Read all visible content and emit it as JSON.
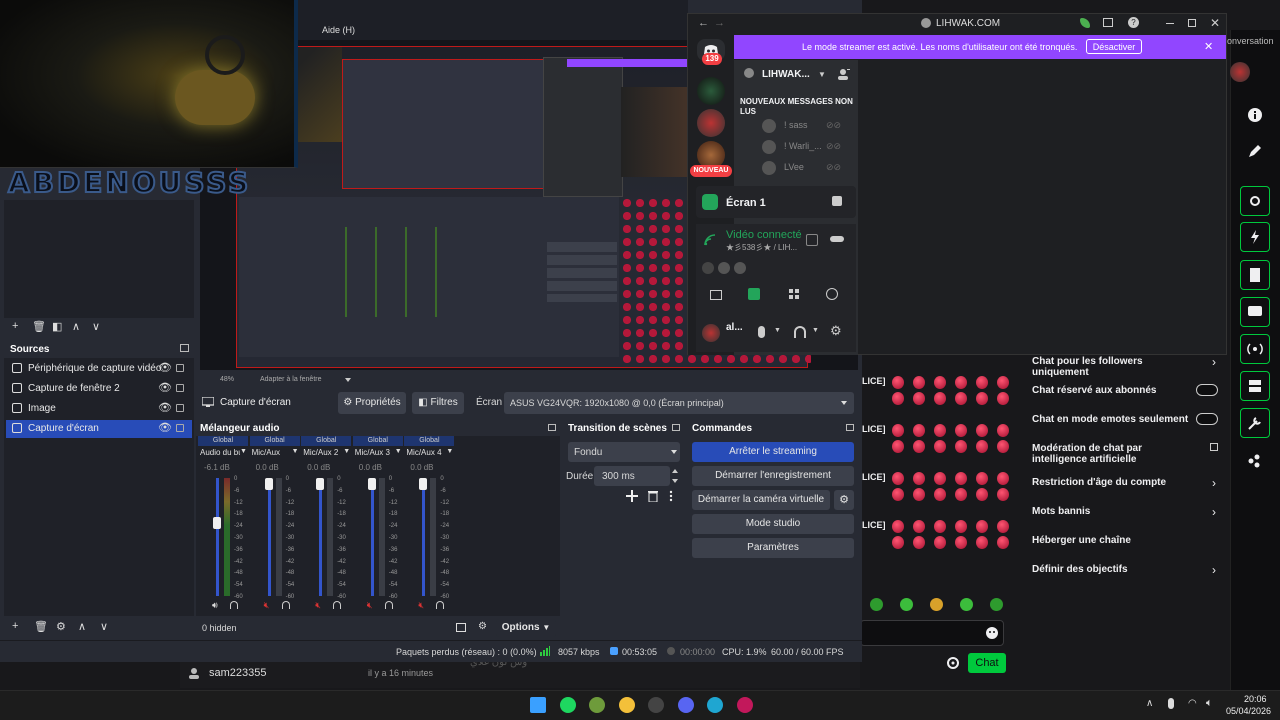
{
  "colors": {
    "obs_bg": "#272a33",
    "obs_panel": "#1f2128",
    "obs_accent": "#284cb8",
    "discord_bg": "#2b2d31",
    "discord_purple": "#9146ff",
    "twitch_green": "#00c93d",
    "chat_send": "#00e676"
  },
  "obs_menu": {
    "help": "Aide (H)"
  },
  "scenes_toolbar": [
    "plus-icon",
    "trash-icon",
    "filter-icon",
    "up-icon",
    "down-icon"
  ],
  "sources": {
    "title": "Sources",
    "items": [
      {
        "label": "Périphérique de capture vidéo",
        "icon": "camera-icon"
      },
      {
        "label": "Capture de fenêtre 2",
        "icon": "window-icon"
      },
      {
        "label": "Image",
        "icon": "image-icon"
      },
      {
        "label": "Capture d'écran",
        "icon": "monitor-icon",
        "selected": true
      }
    ]
  },
  "props_bar": {
    "source": "Capture d'écran",
    "properties": "Propriétés",
    "filters": "Filtres",
    "screen_label": "Écran",
    "screen_value": "ASUS VG24VQR: 1920x1080 @ 0,0 (Écran principal)"
  },
  "preview_bar": {
    "zoom": "48%",
    "fit": "Adapter à la fenêtre"
  },
  "mixer": {
    "title": "Mélangeur audio",
    "channels": [
      {
        "group": "Global",
        "name": "Audio du bureau",
        "db": "-6.1 dB",
        "level": 0.63,
        "muted": false
      },
      {
        "group": "Global",
        "name": "Mic/Aux",
        "db": "0.0 dB",
        "level": 1.0,
        "muted": true
      },
      {
        "group": "Global",
        "name": "Mic/Aux 2",
        "db": "0.0 dB",
        "level": 1.0,
        "muted": true
      },
      {
        "group": "Global",
        "name": "Mic/Aux 3",
        "db": "0.0 dB",
        "level": 1.0,
        "muted": true
      },
      {
        "group": "Global",
        "name": "Mic/Aux 4",
        "db": "0.0 dB",
        "level": 1.0,
        "muted": true
      }
    ],
    "scale": [
      "0",
      "-6",
      "-12",
      "-18",
      "-24",
      "-30",
      "-36",
      "-42",
      "-48",
      "-54",
      "-60"
    ]
  },
  "transitions": {
    "title": "Transition de scènes",
    "type": "Fondu",
    "duration_label": "Durée",
    "duration": "300 ms"
  },
  "controls": {
    "title": "Commandes",
    "stop_stream": "Arrêter le streaming",
    "start_record": "Démarrer l'enregistrement",
    "virtual_cam": "Démarrer la caméra virtuelle",
    "studio": "Mode studio",
    "settings": "Paramètres"
  },
  "bottom_bar": {
    "hidden": "0 hidden",
    "options": "Options"
  },
  "status": {
    "dropped": "Paquets perdus (réseau) : 0 (0.0%)",
    "bitrate": "8057 kbps",
    "stream_time": "00:53:05",
    "rec_time": "00:00:00",
    "cpu": "CPU: 1.9%",
    "fps": "60.00 / 60.00 FPS"
  },
  "webcam": {
    "overlay_text": "ABDENOUSSS"
  },
  "discord": {
    "url": "LIHWAK.COM",
    "notification_count": "139",
    "new_label": "NOUVEAU",
    "banner_text": "Le mode streamer est activé. Les noms d'utilisateur ont été tronqués.",
    "banner_button": "Désactiver",
    "server_name": "LIHWAK...",
    "unread_heading": "NOUVEAUX MESSAGES NON LUS",
    "users": [
      "! sass",
      "! Warli_...",
      "LVee"
    ],
    "channel": "Écran 1",
    "voice_status": "Vidéo connecté",
    "voice_sub": "★彡538彡★ / LIH...",
    "self_name": "al..."
  },
  "twitch": {
    "conversation": "onversation",
    "settings": [
      {
        "label": "Chat pour les followers uniquement",
        "control": "chevron"
      },
      {
        "label": "Chat réservé aux abonnés",
        "control": "toggle"
      },
      {
        "label": "Chat en mode emotes seulement",
        "control": "toggle"
      },
      {
        "label": "Modération de chat par intelligence artificielle",
        "control": "external"
      },
      {
        "label": "Restriction d'âge du compte",
        "control": "chevron"
      },
      {
        "label": "Mots bannis",
        "control": "chevron"
      },
      {
        "label": "Héberger une chaîne",
        "control": "none"
      },
      {
        "label": "Définir des objectifs",
        "control": "chevron"
      }
    ],
    "chat_button": "Chat",
    "police_tag": "OLICE]",
    "user_row": {
      "name": "sam223355",
      "time": "il y a 16 minutes"
    },
    "faded_text": "وش لون غلاي"
  },
  "taskbar": {
    "time": "20:06",
    "date": "05/04/2026"
  }
}
